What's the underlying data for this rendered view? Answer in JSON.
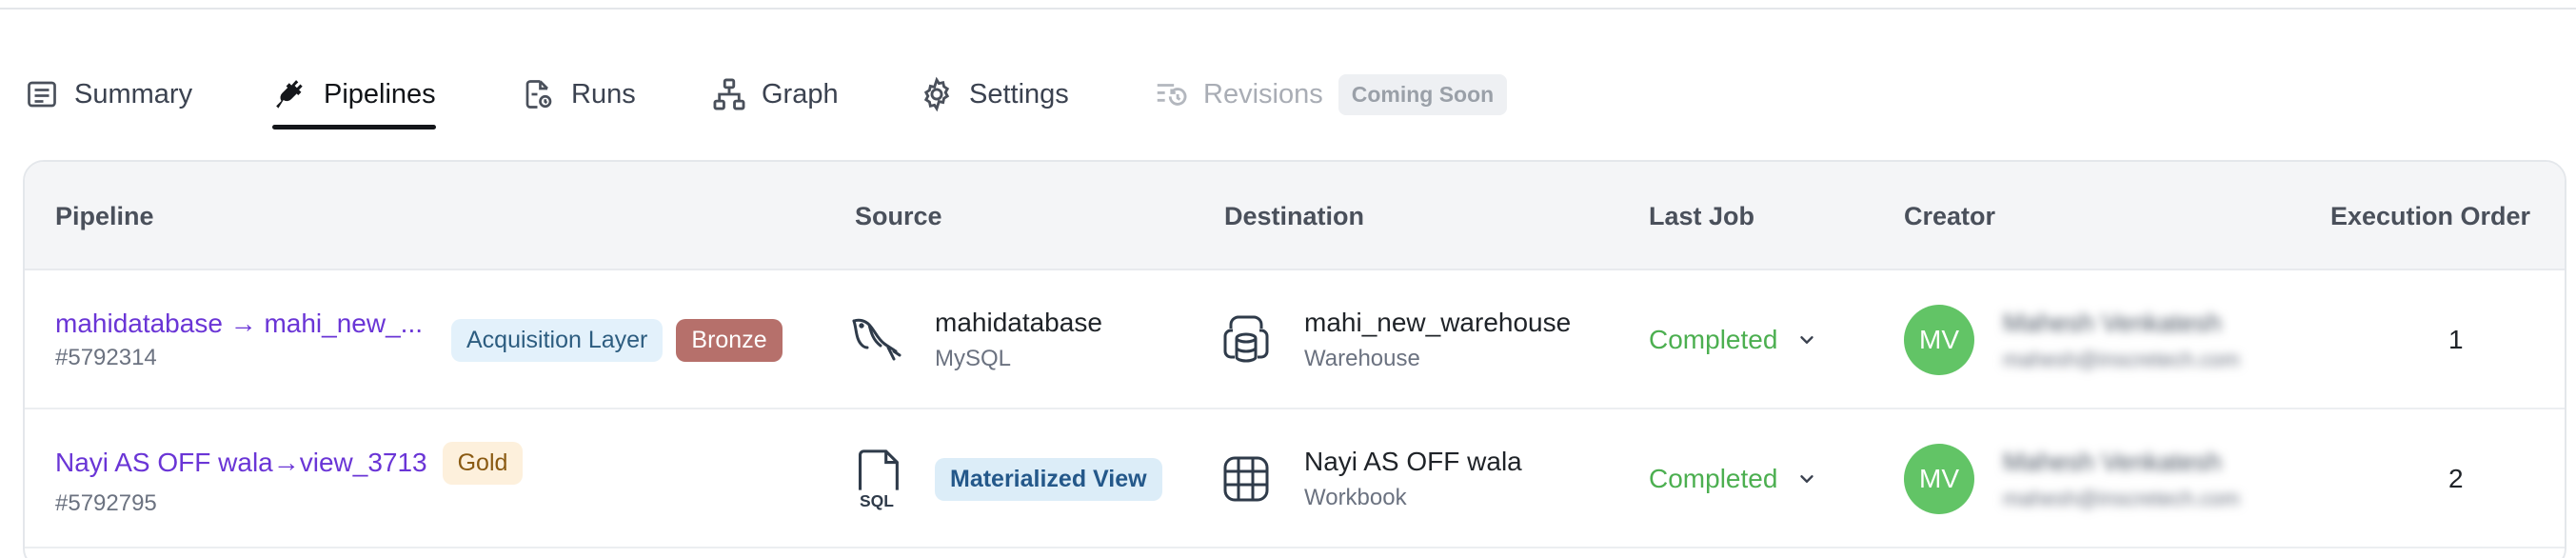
{
  "tabs": [
    {
      "label": "Summary",
      "icon": "summary-icon",
      "active": false,
      "disabled": false
    },
    {
      "label": "Pipelines",
      "icon": "plug-icon",
      "active": true,
      "disabled": false
    },
    {
      "label": "Runs",
      "icon": "runs-icon",
      "active": false,
      "disabled": false
    },
    {
      "label": "Graph",
      "icon": "graph-icon",
      "active": false,
      "disabled": false
    },
    {
      "label": "Settings",
      "icon": "gear-icon",
      "active": false,
      "disabled": false
    },
    {
      "label": "Revisions",
      "icon": "revisions-icon",
      "active": false,
      "disabled": true,
      "badge": "Coming Soon"
    }
  ],
  "table": {
    "headers": {
      "pipeline": "Pipeline",
      "source": "Source",
      "destination": "Destination",
      "last_job": "Last Job",
      "creator": "Creator",
      "execution_order": "Execution Order"
    },
    "rows": [
      {
        "name": "mahidatabase → mahi_new_...",
        "id": "#5792314",
        "tags": [
          "Acquisition Layer",
          "Bronze"
        ],
        "source": {
          "icon": "mysql-dolphin-icon",
          "name": "mahidatabase",
          "type": "MySQL"
        },
        "destination": {
          "icon": "warehouse-icon",
          "name": "mahi_new_warehouse",
          "type": "Warehouse"
        },
        "last_job": "Completed",
        "creator": {
          "initials": "MV",
          "name": "Mahesh Venkatesh",
          "email": "mahesh@inscretech.com"
        },
        "execution_order": "1"
      },
      {
        "name": "Nayi AS OFF wala→view_3713",
        "id": "#5792795",
        "tags": [
          "Gold"
        ],
        "source": {
          "icon": "sql-file-icon",
          "badge": "Materialized View"
        },
        "destination": {
          "icon": "workbook-grid-icon",
          "name": "Nayi AS OFF wala",
          "type": "Workbook"
        },
        "last_job": "Completed",
        "creator": {
          "initials": "MV",
          "name": "Mahesh Venkatesh",
          "email": "mahesh@inscretech.com"
        },
        "execution_order": "2"
      }
    ]
  },
  "colors": {
    "link": "#6a35d6",
    "status_completed": "#4caf50",
    "avatar": "#62c466",
    "bronze": "#b6706b"
  }
}
